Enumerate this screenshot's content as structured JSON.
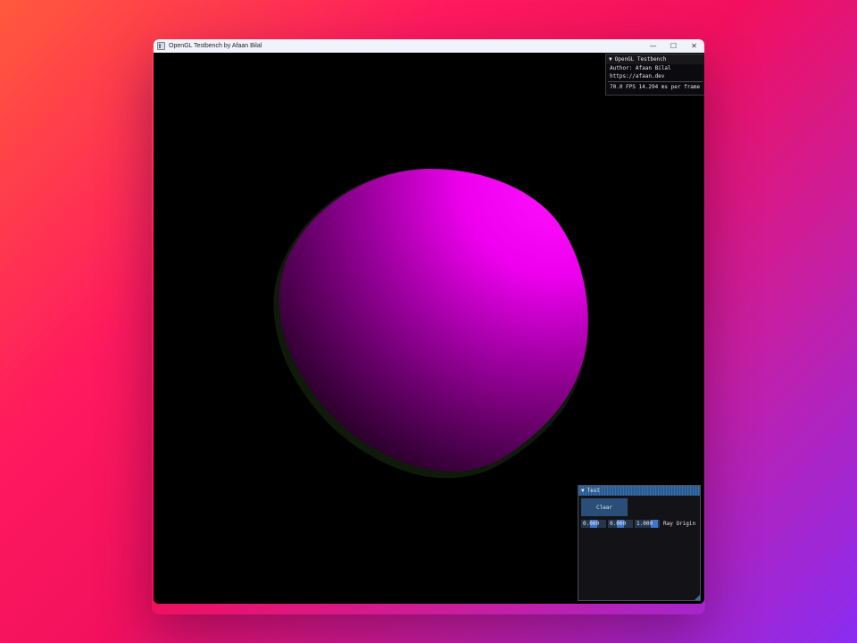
{
  "window": {
    "title": "OpenGL Testbench by Afaan Bilal",
    "controls": {
      "minimize": "—",
      "maximize": "☐",
      "close": "✕"
    }
  },
  "info_panel": {
    "title": "OpenGL Testbench",
    "author": "Author: Afaan Bilal",
    "url": "https://afaan.dev",
    "perf": "70.0 FPS 14.294 ms per frame"
  },
  "test_panel": {
    "title": "Test",
    "clear_label": "Clear",
    "ray_origin": {
      "x": "0.000",
      "y": "0.000",
      "z": "1.000",
      "label": "Ray Origin"
    }
  },
  "sphere": {
    "color": "#ff00ff",
    "background": "#000000"
  },
  "icons": [
    "app-icon",
    "minimize-icon",
    "maximize-icon",
    "close-icon",
    "collapse-triangle-icon"
  ]
}
